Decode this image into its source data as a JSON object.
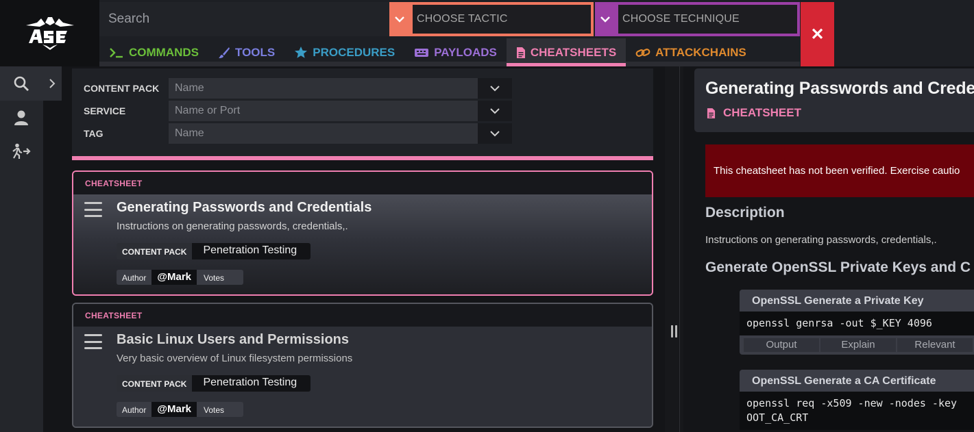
{
  "search": {
    "placeholder": "Search"
  },
  "filters_top": {
    "tactic_placeholder": "CHOOSE TACTIC",
    "technique_placeholder": "CHOOSE TECHNIQUE",
    "close_label": "✕"
  },
  "nav": {
    "tabs": [
      {
        "label": "COMMANDS",
        "icon": "terminal-icon",
        "color": "#6bbf3a",
        "active": false
      },
      {
        "label": "TOOLS",
        "icon": "brush-icon",
        "color": "#7b7fe0",
        "active": false
      },
      {
        "label": "PROCEDURES",
        "icon": "star-icon",
        "color": "#3a9dc6",
        "active": false
      },
      {
        "label": "PAYLOADS",
        "icon": "keyboard-icon",
        "color": "#9b6fd6",
        "active": false
      },
      {
        "label": "CHEATSHEETS",
        "icon": "file-icon",
        "color": "#f07fb1",
        "active": true
      },
      {
        "label": "ATTACKCHAINS",
        "icon": "link-icon",
        "color": "#e08a2e",
        "active": false
      }
    ]
  },
  "sidebar": {
    "items": [
      {
        "icon": "search-icon"
      },
      {
        "icon": "user-icon"
      },
      {
        "icon": "exit-icon"
      }
    ]
  },
  "filter_panel": {
    "rows": [
      {
        "label": "CONTENT PACK",
        "placeholder": "Name"
      },
      {
        "label": "SERVICE",
        "placeholder": "Name or Port"
      },
      {
        "label": "TAG",
        "placeholder": "Name"
      }
    ]
  },
  "cards": [
    {
      "type": "CHEATSHEET",
      "title": "Generating Passwords and Credentials",
      "description": "Instructions on generating passwords, credentials,.",
      "content_pack_label": "CONTENT PACK",
      "content_pack": "Penetration Testing",
      "author_label": "Author",
      "author": "@Mark",
      "votes_label": "Votes"
    },
    {
      "type": "CHEATSHEET",
      "title": "Basic Linux Users and Permissions",
      "description": "Very basic overview of Linux filesystem permissions",
      "content_pack_label": "CONTENT PACK",
      "content_pack": "Penetration Testing",
      "author_label": "Author",
      "author": "@Mark",
      "votes_label": "Votes"
    }
  ],
  "detail": {
    "title": "Generating Passwords and Creden",
    "type": "CHEATSHEET",
    "warning": "This cheatsheet has not been verified. Exercise cautio",
    "description_heading": "Description",
    "description": "Instructions on generating passwords, credentials,.",
    "section_heading": "Generate OpenSSL Private Keys and C",
    "commands": [
      {
        "title": "OpenSSL Generate a Private Key",
        "code": "openssl genrsa -out $_KEY 4096",
        "buttons": [
          "Output",
          "Explain",
          "Relevant"
        ]
      },
      {
        "title": "OpenSSL Generate a CA Certificate",
        "code_line1": "openssl req -x509 -new -nodes -key",
        "code_line2": "OOT_CA_CRT"
      }
    ]
  }
}
